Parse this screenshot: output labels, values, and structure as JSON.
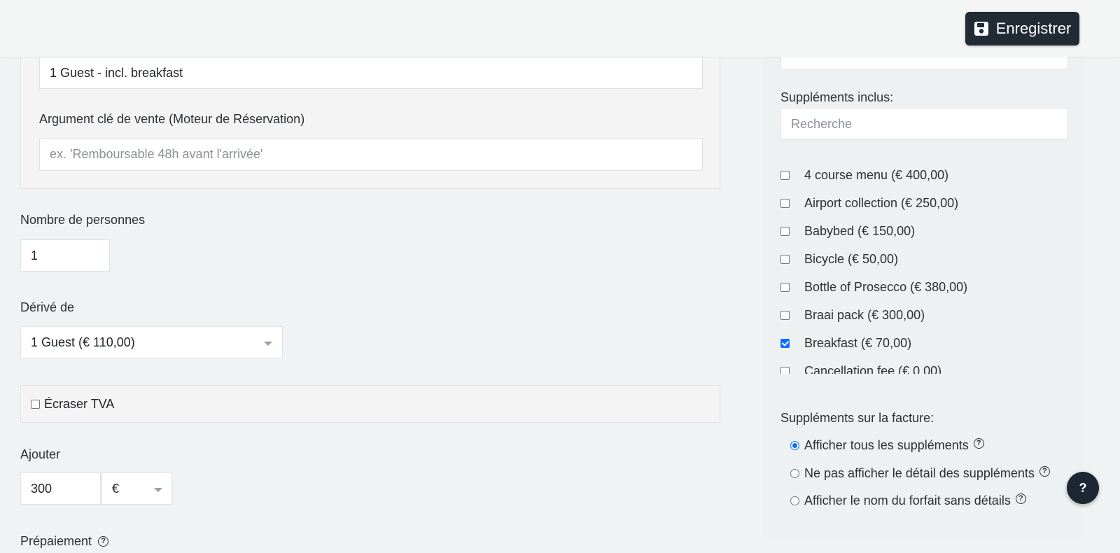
{
  "toolbar": {
    "save_label": "Enregistrer",
    "save_icon": "floppy-disk-icon"
  },
  "form": {
    "name_value": "1 Guest - incl. breakfast",
    "key_argument_label": "Argument clé de vente (Moteur de Réservation)",
    "key_argument_placeholder": "ex. 'Remboursable 48h avant l'arrivée'",
    "persons_label": "Nombre de personnes",
    "persons_value": "1",
    "derived_label": "Dérivé de",
    "derived_value": "1 Guest (€ 110,00)",
    "override_vat_label": "Écraser TVA",
    "add_label": "Ajouter",
    "add_value": "300",
    "add_currency": "€",
    "prepayment_label": "Prépaiement"
  },
  "supplements": {
    "included_label": "Suppléments inclus:",
    "search_placeholder": "Recherche",
    "items": [
      {
        "label": "4 course menu (€ 400,00)",
        "checked": false
      },
      {
        "label": "Airport collection (€ 250,00)",
        "checked": false
      },
      {
        "label": "Babybed (€ 150,00)",
        "checked": false
      },
      {
        "label": "Bicycle (€ 50,00)",
        "checked": false
      },
      {
        "label": "Bottle of Prosecco (€ 380,00)",
        "checked": false
      },
      {
        "label": "Braai pack (€ 300,00)",
        "checked": false
      },
      {
        "label": "Breakfast (€ 70,00)",
        "checked": true
      },
      {
        "label": "Cancellation fee (€ 0,00)",
        "checked": false
      }
    ],
    "invoice_label": "Suppléments sur la facture:",
    "invoice_options": [
      {
        "label": "Afficher tous les suppléments",
        "selected": true
      },
      {
        "label": "Ne pas afficher le détail des suppléments",
        "selected": false
      },
      {
        "label": "Afficher le nom du forfait sans détails",
        "selected": false
      }
    ]
  },
  "help": {
    "button_label": "?"
  },
  "colors": {
    "primary_dark": "#212b34",
    "accent": "#0d6efd",
    "background": "#f0f3f3"
  }
}
